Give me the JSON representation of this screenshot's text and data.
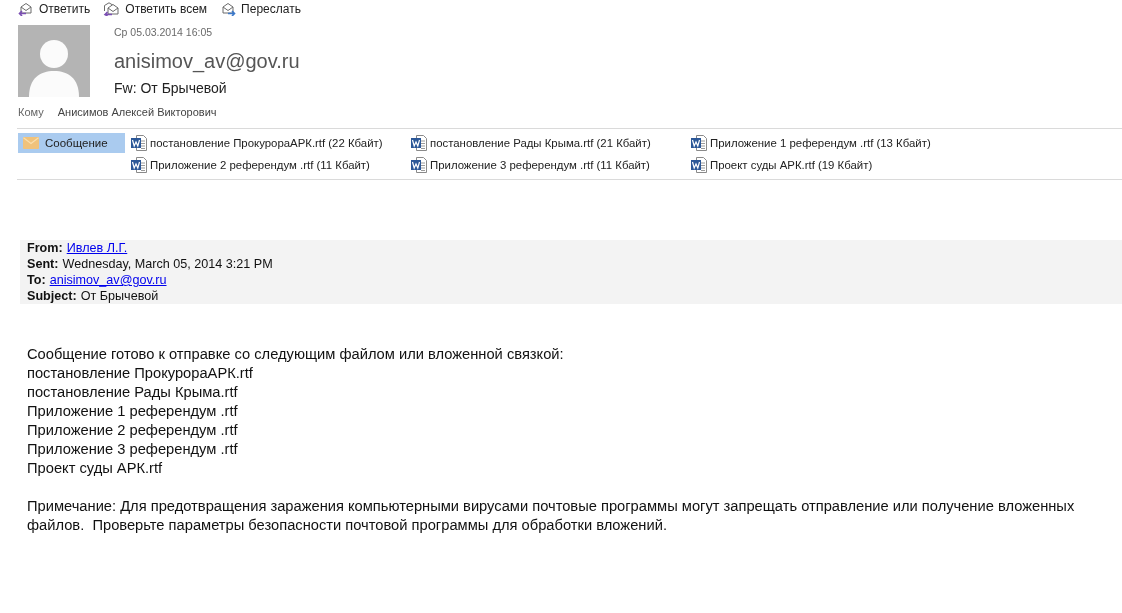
{
  "toolbar": {
    "buttons": [
      {
        "label": "Ответить",
        "kind": "reply"
      },
      {
        "label": "Ответить всем",
        "kind": "reply_all"
      },
      {
        "label": "Переслать",
        "kind": "forward"
      }
    ]
  },
  "header": {
    "date": "Ср 05.03.2014 16:05",
    "sender": "anisimov_av@gov.ru",
    "subject": "Fw: От Брычевой",
    "to_label": "Кому",
    "to": "Анисимов Алексей Викторович"
  },
  "attachments": [
    {
      "label": "Сообщение",
      "kind": "message",
      "selected": true
    },
    {
      "label": "постановление ПрокурораАРК.rtf (22 Кбайт)",
      "kind": "document",
      "selected": false
    },
    {
      "label": "постановление Рады Крыма.rtf (21 Кбайт)",
      "kind": "document",
      "selected": false
    },
    {
      "label": "Приложение 1 референдум .rtf (13 Кбайт)",
      "kind": "document",
      "selected": false
    },
    {
      "label": "Приложение 2 референдум .rtf (11 Кбайт)",
      "kind": "document",
      "selected": false
    },
    {
      "label": "Приложение 3 референдум .rtf (11 Кбайт)",
      "kind": "document",
      "selected": false
    },
    {
      "label": "Проект суды АРК.rtf (19 Кбайт)",
      "kind": "document",
      "selected": false
    }
  ],
  "forwarded_header": {
    "fields": [
      {
        "label": "From:",
        "value": "Ивлев Л.Г.",
        "kind": "link"
      },
      {
        "label": "Sent:",
        "value": "Wednesday, March 05, 2014 3:21 PM",
        "kind": "text"
      },
      {
        "label": "To:",
        "value": "anisimov_av@gov.ru",
        "kind": "link"
      },
      {
        "label": "Subject:",
        "value": "От Брычевой",
        "kind": "text"
      }
    ]
  },
  "body": {
    "intro": "Сообщение готово к отправке со следующим файлом или вложенной связкой:",
    "files": [
      "постановление ПрокурораАРК.rtf",
      "постановление Рады Крыма.rtf",
      "Приложение 1 референдум .rtf",
      "Приложение 2 референдум .rtf",
      "Приложение 3 референдум .rtf",
      "Проект суды АРК.rtf"
    ],
    "note": "Примечание: Для предотвращения заражения компьютерными вирусами почтовые программы могут запрещать отправление или получение вложенных файлов.  Проверьте параметры безопасности почтовой программы для обработки вложений."
  }
}
